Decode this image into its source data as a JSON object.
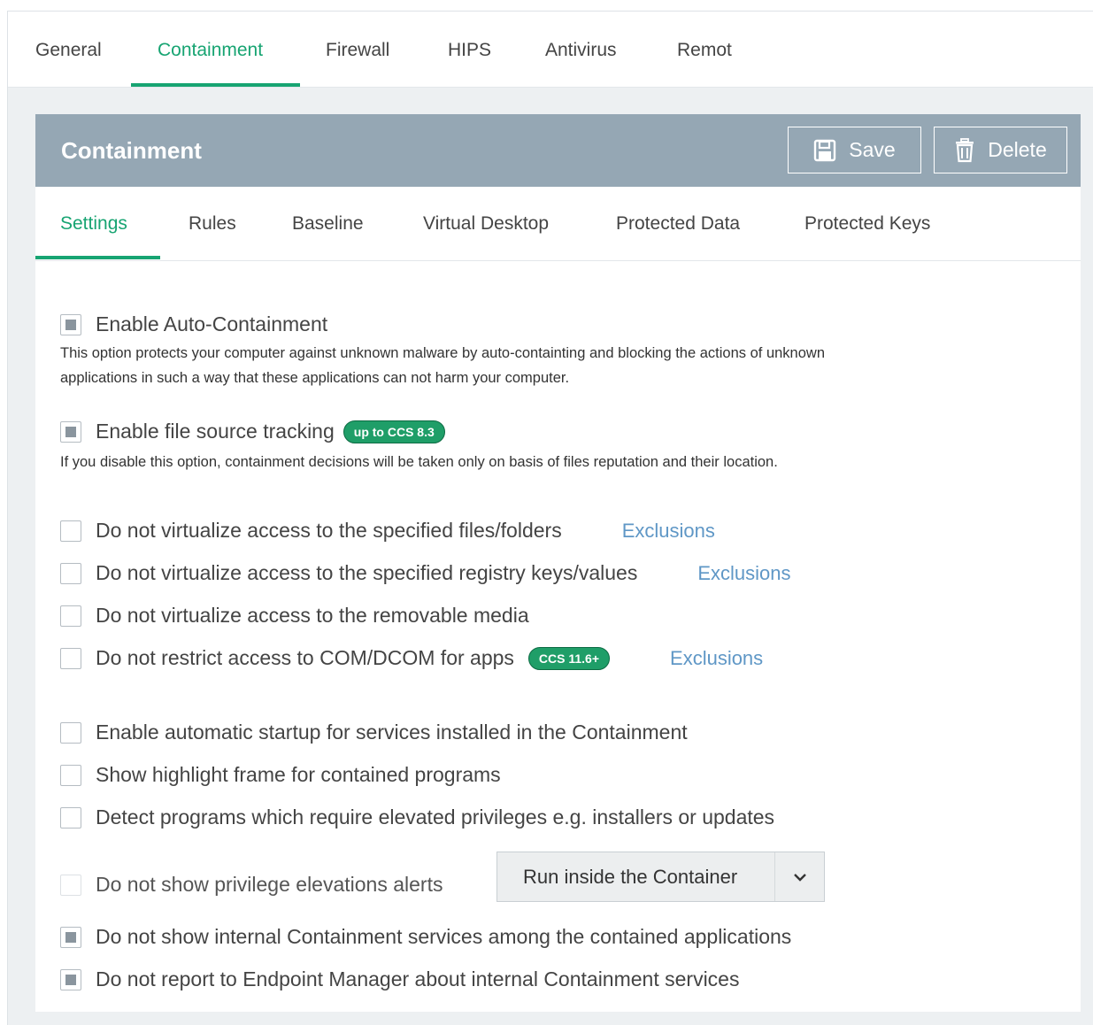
{
  "top_tabs": [
    "General",
    "Containment",
    "Firewall",
    "HIPS",
    "Antivirus",
    "Remot"
  ],
  "panel": {
    "title": "Containment",
    "save_label": "Save",
    "delete_label": "Delete"
  },
  "sub_tabs": [
    "Settings",
    "Rules",
    "Baseline",
    "Virtual Desktop",
    "Protected Data",
    "Protected Keys"
  ],
  "settings": {
    "auto_containment": {
      "label": "Enable Auto-Containment",
      "checked": true,
      "desc_line1": "This option protects your computer against unknown malware by auto-containting and blocking the actions of unknown",
      "desc_line2": "applications in such a way that these applications can not harm your computer."
    },
    "file_source_tracking": {
      "label": "Enable file source tracking",
      "badge": "up to CCS 8.3",
      "checked": true,
      "desc": "If you disable this option, containment decisions will be taken only on basis of files reputation and their location."
    },
    "no_virt_files": {
      "label": "Do not virtualize access to the specified files/folders",
      "link": "Exclusions",
      "checked": false
    },
    "no_virt_registry": {
      "label": "Do not virtualize access to the specified registry keys/values",
      "link": "Exclusions",
      "checked": false
    },
    "no_virt_removable": {
      "label": "Do not virtualize access to the removable media",
      "checked": false
    },
    "no_restrict_com": {
      "label": "Do not restrict access to COM/DCOM for apps",
      "badge": "CCS 11.6+",
      "link": "Exclusions",
      "checked": false
    },
    "auto_startup_services": {
      "label": "Enable automatic startup for services installed in the Containment",
      "checked": false
    },
    "highlight_frame": {
      "label": "Show highlight frame for contained programs",
      "checked": false
    },
    "detect_elevated": {
      "label": "Detect programs which require elevated privileges e.g. installers or updates",
      "checked": false
    },
    "no_privilege_alerts": {
      "label": "Do not show privilege elevations alerts",
      "checked": false,
      "disabled": true,
      "dropdown_value": "Run inside the Container"
    },
    "no_show_internal": {
      "label": "Do not show internal Containment services among the contained applications",
      "checked": true
    },
    "no_report_internal": {
      "label": "Do not report to Endpoint Manager about internal Containment services",
      "checked": true
    }
  },
  "colors": {
    "accent_green": "#17a472",
    "header_bg": "#95a7b4",
    "link_blue": "#5f97c6",
    "badge_green": "#1f9e68"
  }
}
